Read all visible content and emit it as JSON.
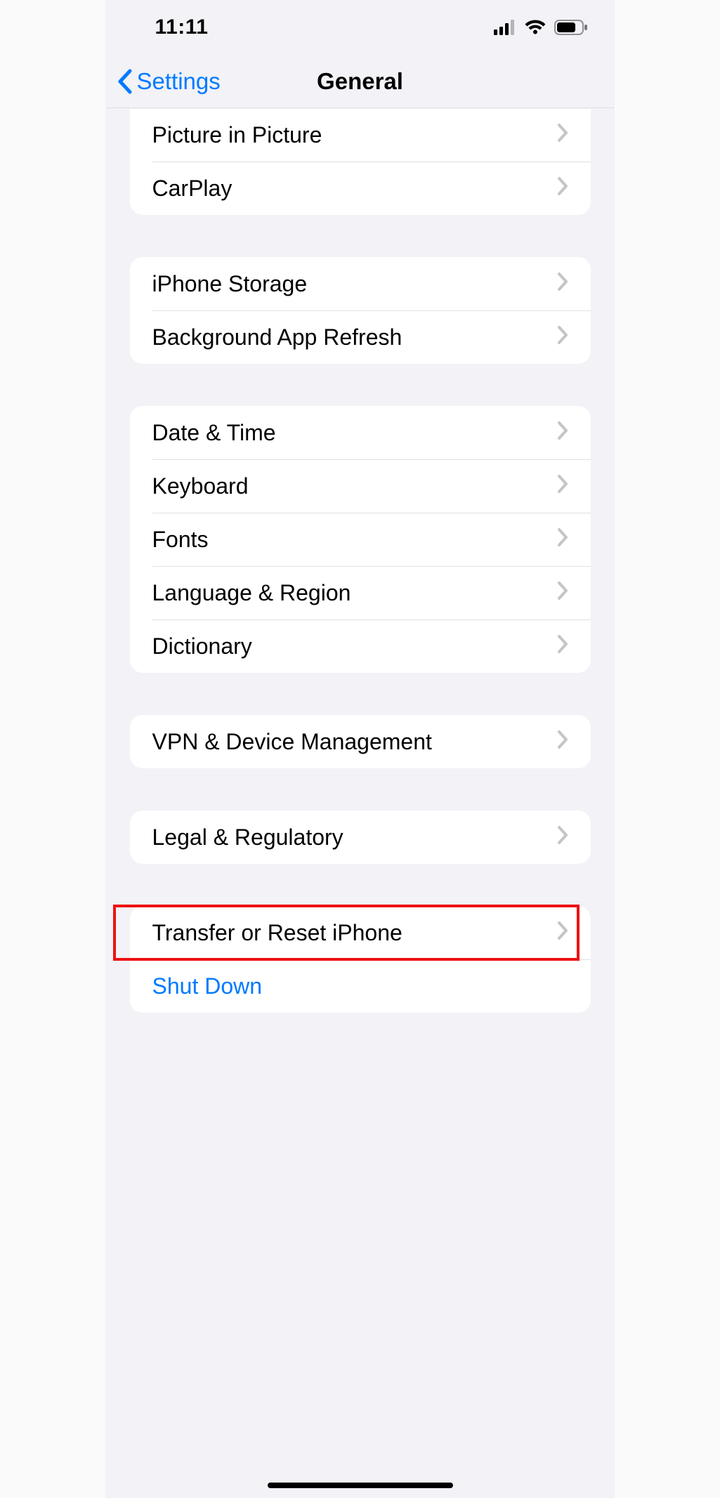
{
  "status": {
    "time": "11:11"
  },
  "nav": {
    "back": "Settings",
    "title": "General"
  },
  "groups": [
    {
      "rows": [
        {
          "label": "Picture in Picture"
        },
        {
          "label": "CarPlay"
        }
      ]
    },
    {
      "rows": [
        {
          "label": "iPhone Storage"
        },
        {
          "label": "Background App Refresh"
        }
      ]
    },
    {
      "rows": [
        {
          "label": "Date & Time"
        },
        {
          "label": "Keyboard"
        },
        {
          "label": "Fonts"
        },
        {
          "label": "Language & Region"
        },
        {
          "label": "Dictionary"
        }
      ]
    },
    {
      "rows": [
        {
          "label": "VPN & Device Management"
        }
      ]
    },
    {
      "rows": [
        {
          "label": "Legal & Regulatory"
        }
      ]
    },
    {
      "rows": [
        {
          "label": "Transfer or Reset iPhone",
          "highlighted": true
        },
        {
          "label": "Shut Down",
          "style": "blue"
        }
      ]
    }
  ]
}
